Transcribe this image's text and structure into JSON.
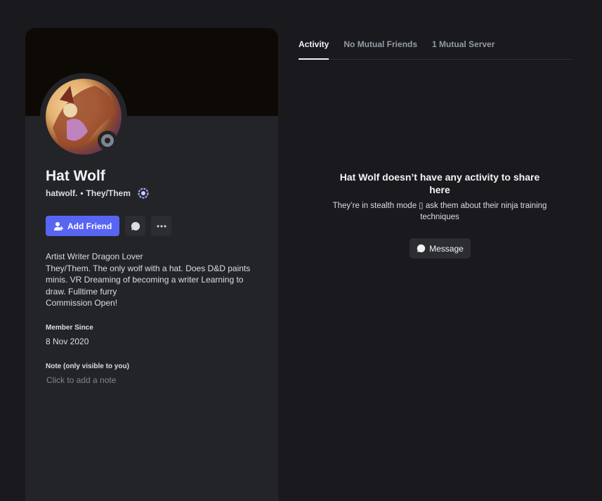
{
  "profile": {
    "display_name": "Hat Wolf",
    "handle": "hatwolf.",
    "separator": "•",
    "pronouns": "They/Them",
    "status": "offline",
    "bio_lines": [
      "Artist Writer Dragon Lover",
      "They/Them. The only wolf with a hat. Does D&D paints minis. VR Dreaming of becoming a writer Learning to draw. Fulltime furry",
      "Commission Open!"
    ],
    "member_since_label": "Member Since",
    "member_since_value": "8 Nov 2020",
    "note_label": "Note (only visible to you)",
    "note_placeholder": "Click to add a note"
  },
  "actions": {
    "add_friend_label": "Add Friend"
  },
  "tabs": [
    {
      "label": "Activity",
      "active": true
    },
    {
      "label": "No Mutual Friends",
      "active": false
    },
    {
      "label": "1 Mutual Server",
      "active": false
    }
  ],
  "empty_state": {
    "title": "Hat Wolf doesn’t have any activity to share here",
    "subtitle": "They’re in stealth mode ▯ ask them about their ninja training techniques",
    "button_label": "Message"
  },
  "colors": {
    "background": "#1a1a1e",
    "card": "#232428",
    "banner": "#0d0904",
    "accent": "#5865f2"
  }
}
